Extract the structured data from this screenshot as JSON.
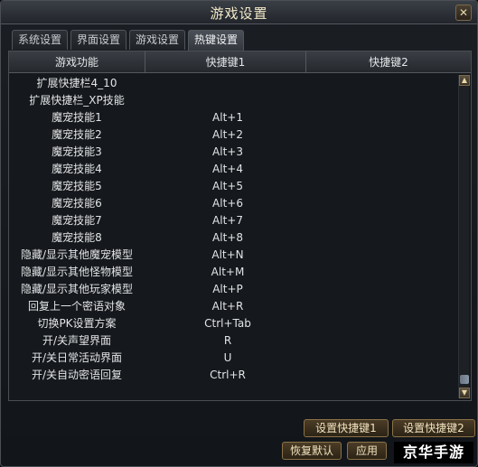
{
  "window": {
    "title": "游戏设置",
    "close_label": "✕"
  },
  "tabs": [
    {
      "label": "系统设置"
    },
    {
      "label": "界面设置"
    },
    {
      "label": "游戏设置"
    },
    {
      "label": "热键设置",
      "active": true
    }
  ],
  "table": {
    "headers": [
      "游戏功能",
      "快捷键1",
      "快捷键2"
    ],
    "rows": [
      {
        "func": "扩展快捷栏4_10",
        "key1": "",
        "key2": ""
      },
      {
        "func": "扩展快捷栏_XP技能",
        "key1": "",
        "key2": ""
      },
      {
        "func": "魔宠技能1",
        "key1": "Alt+1",
        "key2": ""
      },
      {
        "func": "魔宠技能2",
        "key1": "Alt+2",
        "key2": ""
      },
      {
        "func": "魔宠技能3",
        "key1": "Alt+3",
        "key2": ""
      },
      {
        "func": "魔宠技能4",
        "key1": "Alt+4",
        "key2": ""
      },
      {
        "func": "魔宠技能5",
        "key1": "Alt+5",
        "key2": ""
      },
      {
        "func": "魔宠技能6",
        "key1": "Alt+6",
        "key2": ""
      },
      {
        "func": "魔宠技能7",
        "key1": "Alt+7",
        "key2": ""
      },
      {
        "func": "魔宠技能8",
        "key1": "Alt+8",
        "key2": ""
      },
      {
        "func": "隐藏/显示其他魔宠模型",
        "key1": "Alt+N",
        "key2": ""
      },
      {
        "func": "隐藏/显示其他怪物模型",
        "key1": "Alt+M",
        "key2": ""
      },
      {
        "func": "隐藏/显示其他玩家模型",
        "key1": "Alt+P",
        "key2": ""
      },
      {
        "func": "回复上一个密语对象",
        "key1": "Alt+R",
        "key2": ""
      },
      {
        "func": "切换PK设置方案",
        "key1": "Ctrl+Tab",
        "key2": ""
      },
      {
        "func": "开/关声望界面",
        "key1": "R",
        "key2": ""
      },
      {
        "func": "开/关日常活动界面",
        "key1": "U",
        "key2": ""
      },
      {
        "func": "开/关自动密语回复",
        "key1": "Ctrl+R",
        "key2": ""
      }
    ]
  },
  "scrollbar": {
    "up_icon": "▲",
    "down_icon": "▼"
  },
  "buttons": {
    "set_hotkey1": "设置快捷键1",
    "set_hotkey2": "设置快捷键2",
    "restore_default": "恢复默认",
    "apply": "应用",
    "close": "关闭"
  },
  "watermark": {
    "text": "京华手游"
  },
  "colors": {
    "accent_gold": "#8a7248",
    "title_text": "#f3e9c8",
    "background": "#121519"
  }
}
